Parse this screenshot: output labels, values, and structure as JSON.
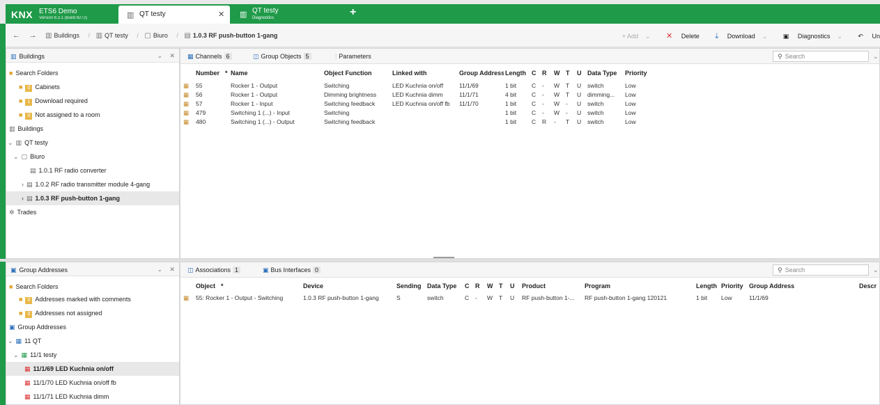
{
  "app": {
    "logo": "KNX",
    "title": "ETS6 Demo",
    "version": "Version 6.3.1 (Build 8272)"
  },
  "tabs": [
    {
      "label": "QT testy",
      "close": "✕"
    },
    {
      "label": "QT testy",
      "sub": "Diagnostics"
    }
  ],
  "tab_add": "+",
  "breadcrumb": {
    "back": "←",
    "forward": "→",
    "items": [
      "Buildings",
      "QT testy",
      "Biuro",
      "1.0.3 RF push-button 1-gang"
    ]
  },
  "actions": {
    "add": "+ Add",
    "delete": "Delete",
    "download": "Download",
    "diagnostics": "Diagnostics",
    "undo": "Un"
  },
  "buildings_panel": {
    "title": "Buildings",
    "items": [
      {
        "label": "Search Folders"
      },
      {
        "count": "0",
        "label": "Cabinets"
      },
      {
        "count": "1",
        "label": "Download required"
      },
      {
        "count": "0",
        "label": "Not assigned to a room"
      },
      {
        "label": "Buildings"
      },
      {
        "label": "QT testy"
      },
      {
        "label": "Biuro"
      },
      {
        "label": "1.0.1 RF radio converter"
      },
      {
        "label": "1.0.2 RF radio transmitter module 4-gang"
      },
      {
        "label": "1.0.3 RF push-button 1-gang"
      },
      {
        "label": "Trades"
      }
    ]
  },
  "group_objects_panel": {
    "tabs": [
      {
        "label": "Channels",
        "count": "6"
      },
      {
        "label": "Group Objects",
        "count": "5"
      },
      {
        "label": "Parameters"
      }
    ],
    "search_placeholder": "Search",
    "columns": [
      "Number",
      "Name",
      "Object Function",
      "Linked with",
      "Group Address",
      "Length",
      "C",
      "R",
      "W",
      "T",
      "U",
      "Data Type",
      "Priority"
    ],
    "rows": [
      [
        "55",
        "Rocker 1 - Output",
        "Switching",
        "LED Kuchnia on/off",
        "11/1/69",
        "1 bit",
        "C",
        "-",
        "W",
        "T",
        "U",
        "switch",
        "Low"
      ],
      [
        "56",
        "Rocker 1 - Output",
        "Dimming brightness",
        "LED Kuchnia dimm",
        "11/1/71",
        "4 bit",
        "C",
        "-",
        "W",
        "T",
        "U",
        "dimming...",
        "Low"
      ],
      [
        "57",
        "Rocker 1 - Input",
        "Switching feedback",
        "LED Kuchnia on/off fb",
        "11/1/70",
        "1 bit",
        "C",
        "-",
        "W",
        "-",
        "U",
        "switch",
        "Low"
      ],
      [
        "479",
        "Switching 1 (...) - Input",
        "Switching",
        "",
        "",
        "1 bit",
        "C",
        "-",
        "W",
        "-",
        "U",
        "switch",
        "Low"
      ],
      [
        "480",
        "Switching 1 (...) - Output",
        "Switching feedback",
        "",
        "",
        "1 bit",
        "C",
        "R",
        "-",
        "T",
        "U",
        "switch",
        "Low"
      ]
    ]
  },
  "ga_panel": {
    "title": "Group Addresses",
    "items": [
      {
        "label": "Search Folders"
      },
      {
        "count": "0",
        "label": "Addresses marked with comments"
      },
      {
        "count": "0",
        "label": "Addresses not assigned"
      },
      {
        "label": "Group Addresses"
      },
      {
        "label": "11 QT"
      },
      {
        "label": "11/1 testy"
      },
      {
        "label": "11/1/69 LED Kuchnia on/off"
      },
      {
        "label": "11/1/70 LED Kuchnia on/off fb"
      },
      {
        "label": "11/1/71 LED Kuchnia dimm"
      }
    ]
  },
  "assoc_panel": {
    "tabs": [
      {
        "label": "Associations",
        "count": "1"
      },
      {
        "label": "Bus Interfaces",
        "count": "0"
      }
    ],
    "search_placeholder": "Search",
    "columns": [
      "Object",
      "Device",
      "Sending",
      "Data Type",
      "C",
      "R",
      "W",
      "T",
      "U",
      "Product",
      "Program",
      "Length",
      "Priority",
      "Group Address",
      "Descr"
    ],
    "rows": [
      [
        "55: Rocker 1 - Output - Switching",
        "1.0.3 RF push-button 1-gang",
        "S",
        "switch",
        "C",
        "-",
        "W",
        "T",
        "U",
        "RF push-button 1-...",
        "RF push-button 1-gang 120121",
        "1 bit",
        "Low",
        "11/1/69",
        ""
      ]
    ]
  }
}
